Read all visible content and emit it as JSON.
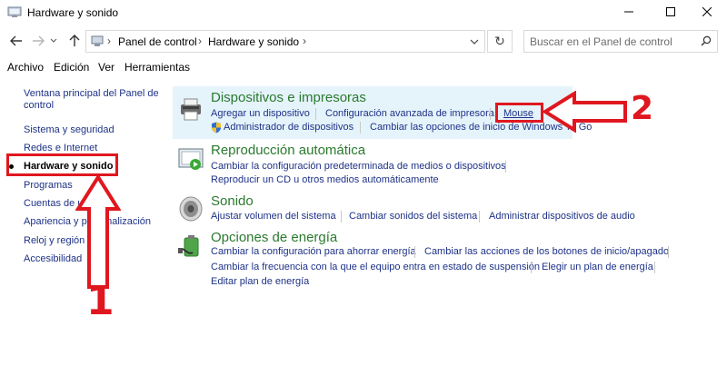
{
  "window": {
    "title": "Hardware y sonido"
  },
  "address": {
    "crumbs": [
      "Panel de control",
      "Hardware y sonido"
    ],
    "separator": "›",
    "dropdown": "⌄",
    "refresh": "↻"
  },
  "search": {
    "placeholder": "Buscar en el Panel de control"
  },
  "menu": [
    "Archivo",
    "Edición",
    "Ver",
    "Herramientas"
  ],
  "sidebar": {
    "items": [
      {
        "label": "Ventana principal del Panel de"
      },
      {
        "label": "control"
      },
      {
        "label": "Sistema y seguridad"
      },
      {
        "label": "Redes e Internet"
      },
      {
        "label": "Hardware y sonido",
        "current": true
      },
      {
        "label": "Programas"
      },
      {
        "label": "Cuentas de usuario"
      },
      {
        "label": "Apariencia y personalización"
      },
      {
        "label": "Reloj y región"
      },
      {
        "label": "Accesibilidad"
      }
    ]
  },
  "categories": {
    "devices": {
      "title": "Dispositivos e impresoras",
      "links": [
        "Agregar un dispositivo",
        "Configuración avanzada de impresora",
        "Mouse",
        "Administrador de dispositivos",
        "Cambiar las opciones de inicio de Windows To Go"
      ]
    },
    "autoplay": {
      "title": "Reproducción automática",
      "links": [
        "Cambiar la configuración predeterminada de medios o dispositivos",
        "Reproducir un CD u otros medios automáticamente"
      ]
    },
    "sound": {
      "title": "Sonido",
      "links": [
        "Ajustar volumen del sistema",
        "Cambiar sonidos del sistema",
        "Administrar dispositivos de audio"
      ]
    },
    "power": {
      "title": "Opciones de energía",
      "links": [
        "Cambiar la configuración para ahorrar energía",
        "Cambiar las acciones de los botones de inicio/apagado",
        "Cambiar la frecuencia con la que el equipo entra en estado de suspensión",
        "Elegir un plan de energía",
        "Editar plan de energía"
      ]
    }
  },
  "annotations": {
    "step1": "1",
    "step2": "2",
    "color": "#e0171f"
  },
  "colors": {
    "link": "#1e3287",
    "category_title": "#2a7a2e",
    "highlight": "#e5f3fb"
  }
}
